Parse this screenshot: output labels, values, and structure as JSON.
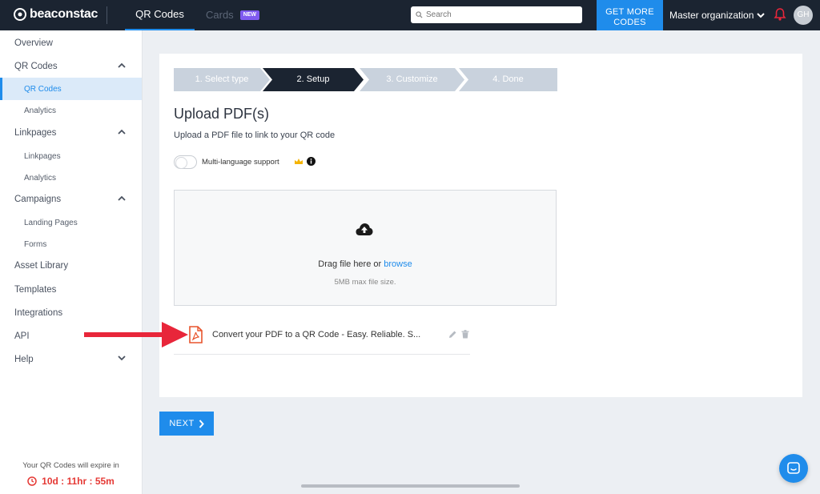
{
  "app": {
    "logo_text": "beaconstac",
    "tabs": {
      "qr_codes": "QR Codes",
      "cards": "Cards",
      "cards_badge": "NEW"
    },
    "search_placeholder": "Search",
    "get_more_line1": "GET MORE",
    "get_more_line2": "CODES",
    "organization": "Master organization",
    "avatar_initials": "GH"
  },
  "sidebar": {
    "overview": "Overview",
    "qr_codes": "QR Codes",
    "qr_codes_sub": "QR Codes",
    "qr_analytics": "Analytics",
    "linkpages": "Linkpages",
    "linkpages_sub": "Linkpages",
    "link_analytics": "Analytics",
    "campaigns": "Campaigns",
    "landing_pages": "Landing Pages",
    "forms": "Forms",
    "asset_library": "Asset Library",
    "templates": "Templates",
    "integrations": "Integrations",
    "api": "API",
    "help": "Help",
    "expire_text": "Your QR Codes will expire in",
    "timer": "10d : 11hr : 55m"
  },
  "wizard": {
    "steps": [
      "1. Select type",
      "2. Setup",
      "3. Customize",
      "4. Done"
    ],
    "active_step": 2,
    "title": "Upload PDF(s)",
    "subtitle": "Upload a PDF file to link to your QR code",
    "multilang_label": "Multi-language support",
    "multilang_enabled": false,
    "drop_text": "Drag file here or",
    "browse_link": "browse",
    "max_size": "5MB max file size.",
    "file_name": "Convert your PDF to a QR Code - Easy. Reliable. S...",
    "next_label": "NEXT"
  },
  "colors": {
    "accent": "#1f8ceb",
    "topbar": "#1b2431",
    "arrow": "#e8263a",
    "pdf": "#e8542d"
  }
}
